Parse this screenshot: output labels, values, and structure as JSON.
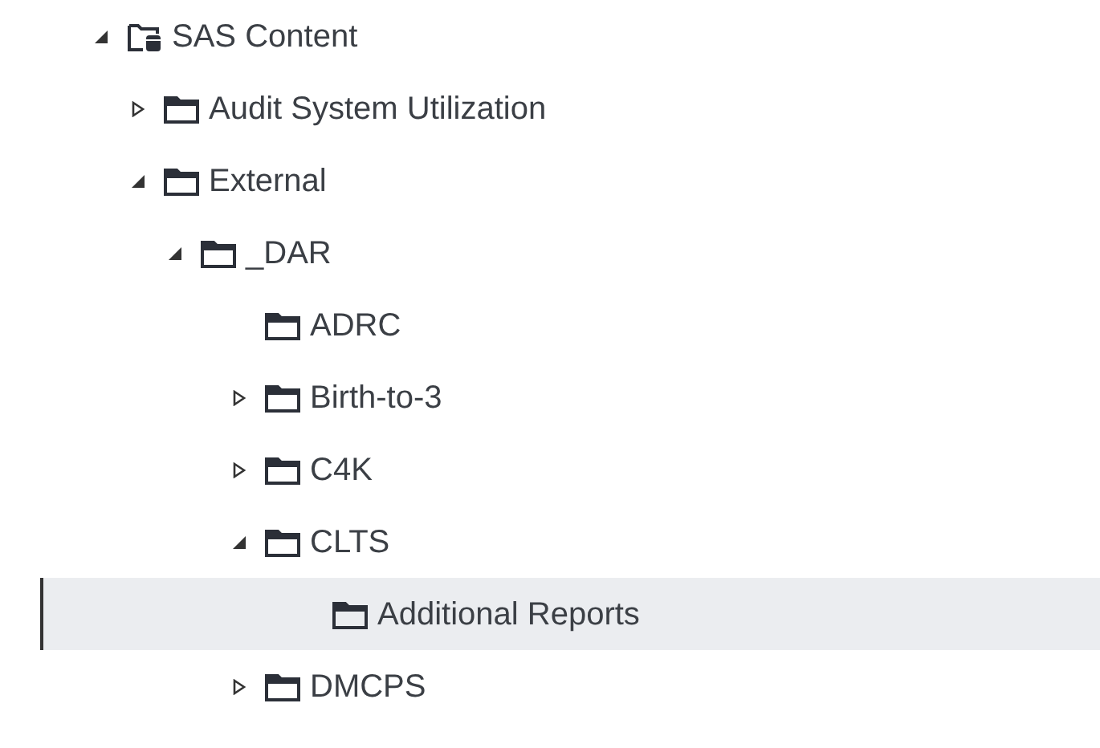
{
  "tree": [
    {
      "label": "SAS Content",
      "kind": "content-root",
      "expanded": true,
      "selected": false,
      "children": [
        {
          "label": "Audit System Utilization",
          "kind": "folder",
          "expanded": false,
          "selected": false
        },
        {
          "label": "External",
          "kind": "folder",
          "expanded": true,
          "selected": false,
          "children": [
            {
              "label": "_DAR",
              "kind": "folder",
              "expanded": true,
              "selected": false,
              "children": [
                {
                  "label": "ADRC",
                  "kind": "folder",
                  "selected": false
                },
                {
                  "label": "Birth-to-3",
                  "kind": "folder",
                  "expanded": false,
                  "selected": false
                },
                {
                  "label": "C4K",
                  "kind": "folder",
                  "expanded": false,
                  "selected": false
                },
                {
                  "label": "CLTS",
                  "kind": "folder",
                  "expanded": true,
                  "selected": false,
                  "children": [
                    {
                      "label": "Additional Reports",
                      "kind": "folder",
                      "selected": true
                    }
                  ]
                },
                {
                  "label": "DMCPS",
                  "kind": "folder",
                  "expanded": false,
                  "selected": false
                }
              ]
            }
          ]
        }
      ]
    }
  ]
}
